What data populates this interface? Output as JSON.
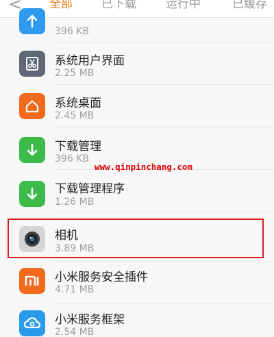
{
  "header": {
    "back_glyph": "<",
    "tabs": [
      {
        "label": "全部",
        "active": true
      },
      {
        "label": "已下载",
        "active": false
      },
      {
        "label": "运行中",
        "active": false
      },
      {
        "label": "已缓存",
        "active": false
      }
    ]
  },
  "apps": [
    {
      "name": "",
      "size": "396 KB",
      "icon": "arrow-up-icon",
      "color": "#2f9bf0"
    },
    {
      "name": "系统用户界面",
      "size": "2.25 MB",
      "icon": "system-ui-icon",
      "color": "#5e6878"
    },
    {
      "name": "系统桌面",
      "size": "2.45 MB",
      "icon": "home-icon",
      "color": "#f26a1b"
    },
    {
      "name": "下载管理",
      "size": "396 KB",
      "icon": "download-icon",
      "color": "#3dbb4a"
    },
    {
      "name": "下载管理程序",
      "size": "1.26 MB",
      "icon": "download-icon",
      "color": "#3dbb4a"
    },
    {
      "name": "相机",
      "size": "3.89 MB",
      "icon": "camera-icon",
      "color": "#d5d5d5",
      "highlighted": true
    },
    {
      "name": "小米服务安全插件",
      "size": "4.71 MB",
      "icon": "mi-logo-icon",
      "color": "#f26a1b"
    },
    {
      "name": "小米服务框架",
      "size": "2.54 MB",
      "icon": "cloud-icon",
      "color": "#2a9be8"
    }
  ],
  "watermark": "www.qinpinchang.com",
  "colors": {
    "accent": "#f27c16",
    "highlight_border": "#e21b1b",
    "watermark": "#e00000"
  }
}
